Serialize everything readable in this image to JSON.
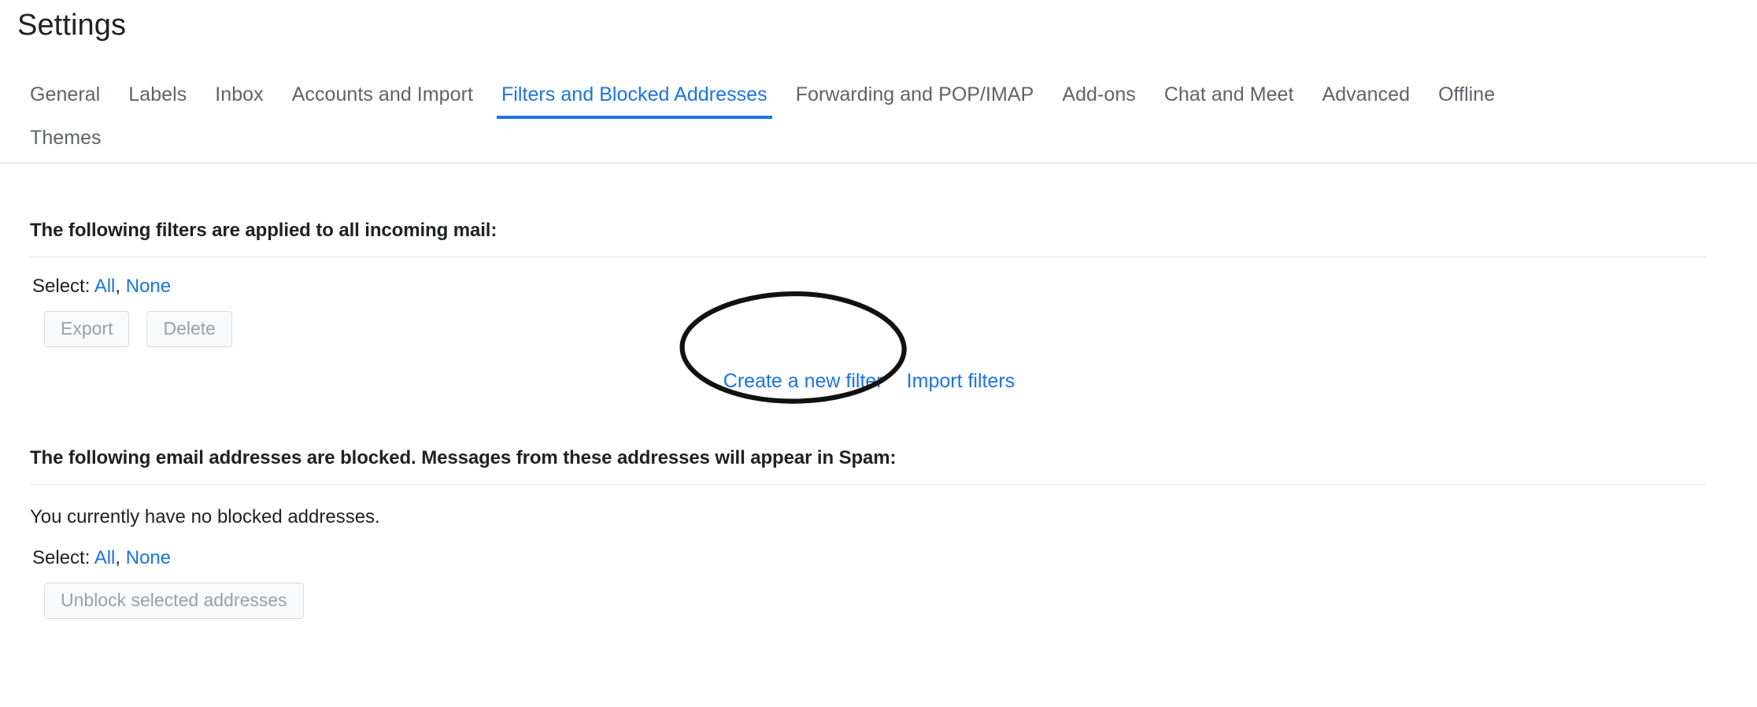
{
  "page": {
    "title": "Settings"
  },
  "tabs": [
    {
      "label": "General",
      "active": false
    },
    {
      "label": "Labels",
      "active": false
    },
    {
      "label": "Inbox",
      "active": false
    },
    {
      "label": "Accounts and Import",
      "active": false
    },
    {
      "label": "Filters and Blocked Addresses",
      "active": true
    },
    {
      "label": "Forwarding and POP/IMAP",
      "active": false
    },
    {
      "label": "Add-ons",
      "active": false
    },
    {
      "label": "Chat and Meet",
      "active": false
    },
    {
      "label": "Advanced",
      "active": false
    },
    {
      "label": "Offline",
      "active": false
    },
    {
      "label": "Themes",
      "active": false
    }
  ],
  "filters_section": {
    "heading": "The following filters are applied to all incoming mail:",
    "select_label": "Select:",
    "select_all": "All",
    "select_separator": ",",
    "select_none": "None",
    "export_button": "Export",
    "delete_button": "Delete",
    "create_filter_link": "Create a new filter",
    "import_filters_link": "Import filters"
  },
  "blocked_section": {
    "heading": "The following email addresses are blocked. Messages from these addresses will appear in Spam:",
    "empty_message": "You currently have no blocked addresses.",
    "select_label": "Select:",
    "select_all": "All",
    "select_separator": ",",
    "select_none": "None",
    "unblock_button": "Unblock selected addresses"
  },
  "annotation": {
    "shape": "ellipse",
    "target": "Create a new filter",
    "color": "#111111"
  },
  "colors": {
    "accent": "#1a73e8",
    "text": "#202124",
    "muted": "#5f6368",
    "disabled_text": "#9aa0a6",
    "divider": "#e0e0e0",
    "tab_divider": "#e8eaed",
    "button_bg": "#f8f9fa",
    "button_border": "#dadce0",
    "background": "#ffffff"
  }
}
